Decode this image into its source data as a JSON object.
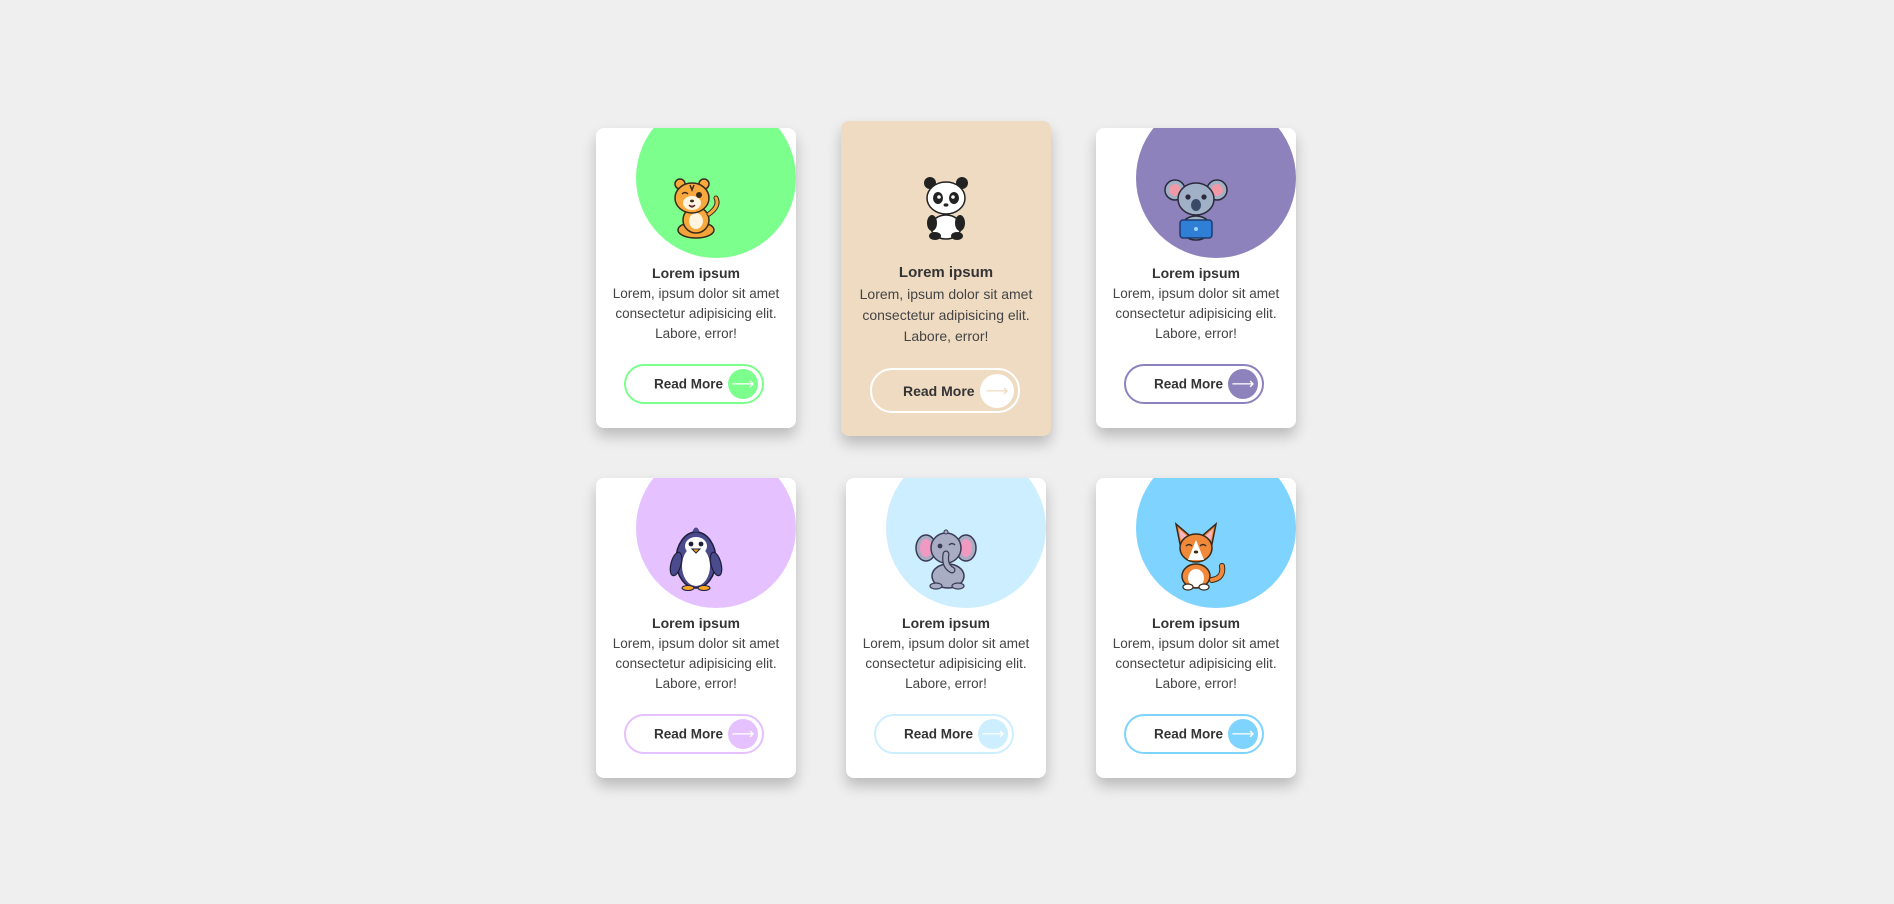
{
  "cards": [
    {
      "title": "Lorem ipsum",
      "body": "Lorem, ipsum dolor sit amet consectetur adipisicing elit. Labore, error!",
      "button": "Read More",
      "arrow": "⟶",
      "accent": "#7dff8d",
      "animal": "tiger-icon",
      "featured": false
    },
    {
      "title": "Lorem ipsum",
      "body": "Lorem, ipsum dolor sit amet consectetur adipisicing elit. Labore, error!",
      "button": "Read More",
      "arrow": "⟶",
      "accent": "#efdbc2",
      "animal": "panda-icon",
      "featured": true
    },
    {
      "title": "Lorem ipsum",
      "body": "Lorem, ipsum dolor sit amet consectetur adipisicing elit. Labore, error!",
      "button": "Read More",
      "arrow": "⟶",
      "accent": "#8e82bc",
      "animal": "koala-icon",
      "featured": false
    },
    {
      "title": "Lorem ipsum",
      "body": "Lorem, ipsum dolor sit amet consectetur adipisicing elit. Labore, error!",
      "button": "Read More",
      "arrow": "⟶",
      "accent": "#e5c1ff",
      "animal": "penguin-icon",
      "featured": false
    },
    {
      "title": "Lorem ipsum",
      "body": "Lorem, ipsum dolor sit amet consectetur adipisicing elit. Labore, error!",
      "button": "Read More",
      "arrow": "⟶",
      "accent": "#cdeeff",
      "animal": "elephant-icon",
      "featured": false
    },
    {
      "title": "Lorem ipsum",
      "body": "Lorem, ipsum dolor sit amet consectetur adipisicing elit. Labore, error!",
      "button": "Read More",
      "arrow": "⟶",
      "accent": "#7ed3ff",
      "animal": "fox-icon",
      "featured": false
    }
  ]
}
